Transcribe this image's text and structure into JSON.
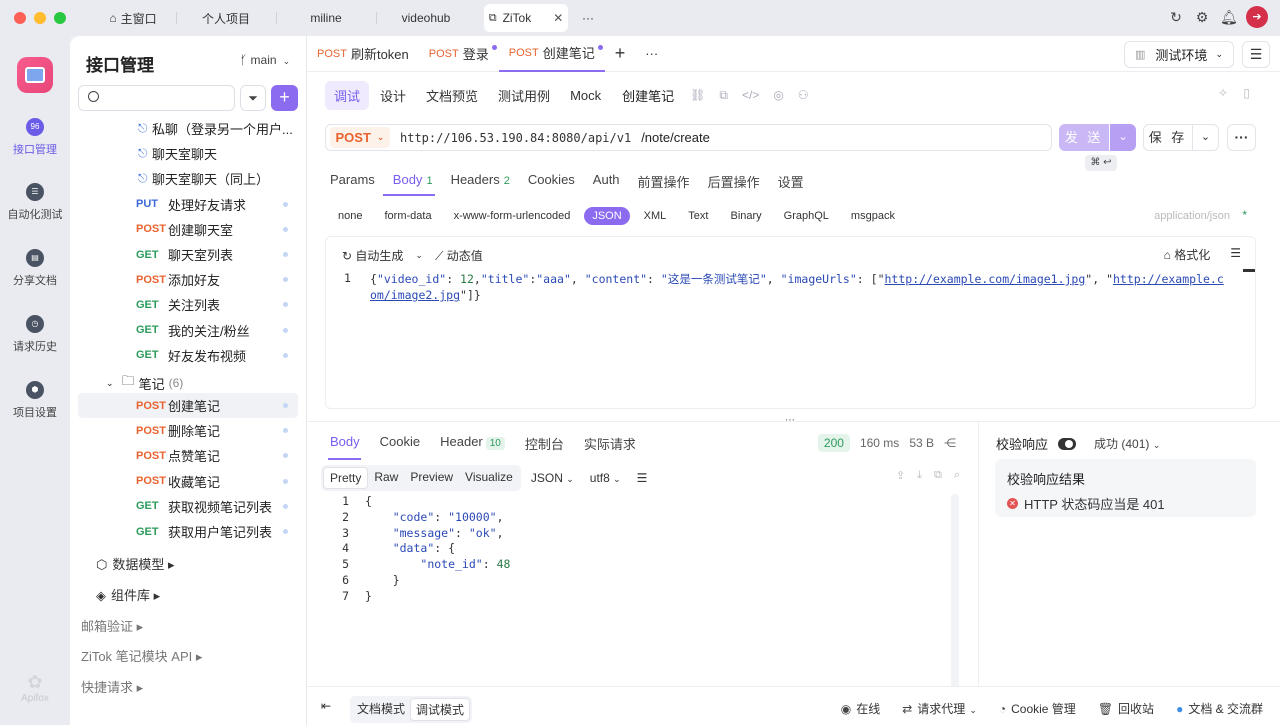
{
  "window": {
    "tabs": [
      {
        "label": "主窗口"
      },
      {
        "label": "个人项目"
      },
      {
        "label": "miline"
      },
      {
        "label": "videohub"
      },
      {
        "label": "ZiTok"
      }
    ],
    "more": "···"
  },
  "rail": {
    "items": [
      {
        "label": "接口管理",
        "active": true
      },
      {
        "label": "自动化测试"
      },
      {
        "label": "分享文档"
      },
      {
        "label": "请求历史"
      },
      {
        "label": "项目设置"
      }
    ],
    "footer": "Apifox"
  },
  "sidebar": {
    "title": "接口管理",
    "branch": "main",
    "tree": [
      {
        "type": "link",
        "label": "私聊（登录另一个用户..."
      },
      {
        "type": "link",
        "label": "聊天室聊天"
      },
      {
        "type": "link",
        "label": "聊天室聊天（同上）"
      },
      {
        "method": "PUT",
        "label": "处理好友请求"
      },
      {
        "method": "POST",
        "label": "创建聊天室"
      },
      {
        "method": "GET",
        "label": "聊天室列表"
      },
      {
        "method": "POST",
        "label": "添加好友"
      },
      {
        "method": "GET",
        "label": "关注列表"
      },
      {
        "method": "GET",
        "label": "我的关注/粉丝"
      },
      {
        "method": "GET",
        "label": "好友发布视频"
      }
    ],
    "folder": {
      "label": "笔记",
      "count": "(6)"
    },
    "notes": [
      {
        "method": "POST",
        "label": "创建笔记",
        "selected": true
      },
      {
        "method": "POST",
        "label": "删除笔记"
      },
      {
        "method": "POST",
        "label": "点赞笔记"
      },
      {
        "method": "POST",
        "label": "收藏笔记"
      },
      {
        "method": "GET",
        "label": "获取视频笔记列表"
      },
      {
        "method": "GET",
        "label": "获取用户笔记列表"
      }
    ],
    "groups": [
      {
        "label": "数据模型 ▸"
      },
      {
        "label": "组件库 ▸"
      },
      {
        "label": "邮箱验证 ▸"
      },
      {
        "label": "ZiTok 笔记模块 API ▸"
      },
      {
        "label": "快捷请求 ▸"
      }
    ]
  },
  "req_tabs": [
    {
      "method": "POST",
      "label": "刷新token"
    },
    {
      "method": "POST",
      "label": "登录"
    },
    {
      "method": "POST",
      "label": "创建笔记"
    }
  ],
  "environment": "测试环境",
  "sub_tabs": [
    "调试",
    "设计",
    "文档预览",
    "测试用例",
    "Mock"
  ],
  "endpoint_name": "创建笔记",
  "request": {
    "method": "POST",
    "base_url": "http://106.53.190.84:8080/api/v1",
    "path": "/note/create",
    "send_label": "发 送",
    "shortcut": "⌘ ↩",
    "save_label": "保 存"
  },
  "param_tabs": [
    {
      "label": "Params"
    },
    {
      "label": "Body",
      "badge": "1",
      "active": true
    },
    {
      "label": "Headers",
      "badge": "2"
    },
    {
      "label": "Cookies"
    },
    {
      "label": "Auth"
    },
    {
      "label": "前置操作"
    },
    {
      "label": "后置操作"
    },
    {
      "label": "设置"
    }
  ],
  "body_types": [
    "none",
    "form-data",
    "x-www-form-urlencoded",
    "JSON",
    "XML",
    "Text",
    "Binary",
    "GraphQL",
    "msgpack"
  ],
  "body_type_active": "JSON",
  "content_type": "application/json",
  "editor": {
    "auto_gen": "自动生成",
    "dynamic": "动态值",
    "format": "格式化",
    "line": "1",
    "body": {
      "video_id": 12,
      "title": "aaa",
      "content": "这是一条测试笔记",
      "imageUrls": [
        "http://example.com/image1.jpg",
        "http://example.com/image2.jpg"
      ]
    }
  },
  "response": {
    "tabs": [
      {
        "label": "Body",
        "active": true
      },
      {
        "label": "Cookie"
      },
      {
        "label": "Header",
        "badge": "10"
      },
      {
        "label": "控制台"
      },
      {
        "label": "实际请求"
      }
    ],
    "status": "200",
    "time": "160 ms",
    "size": "53 B",
    "views": [
      "Pretty",
      "Raw",
      "Preview",
      "Visualize"
    ],
    "format": "JSON",
    "encoding": "utf8",
    "line_numbers": [
      "1",
      "2",
      "3",
      "4",
      "5",
      "6",
      "7"
    ],
    "code": "{\n    \"code\": \"10000\",\n    \"message\": \"ok\",\n    \"data\": {\n        \"note_id\": 48\n    }\n}"
  },
  "validation": {
    "label": "校验响应",
    "status": "成功 (401)",
    "title": "校验响应结果",
    "result": "HTTP 状态码应当是 401"
  },
  "statusbar": {
    "modes": [
      "文档模式",
      "调试模式"
    ],
    "items": [
      "在线",
      "请求代理",
      "Cookie 管理",
      "回收站",
      "文档 & 交流群"
    ]
  },
  "colors": {
    "accent": "#8b6cf0",
    "post": "#e8632f",
    "get": "#2c9b5c",
    "put": "#3d6ad8"
  }
}
